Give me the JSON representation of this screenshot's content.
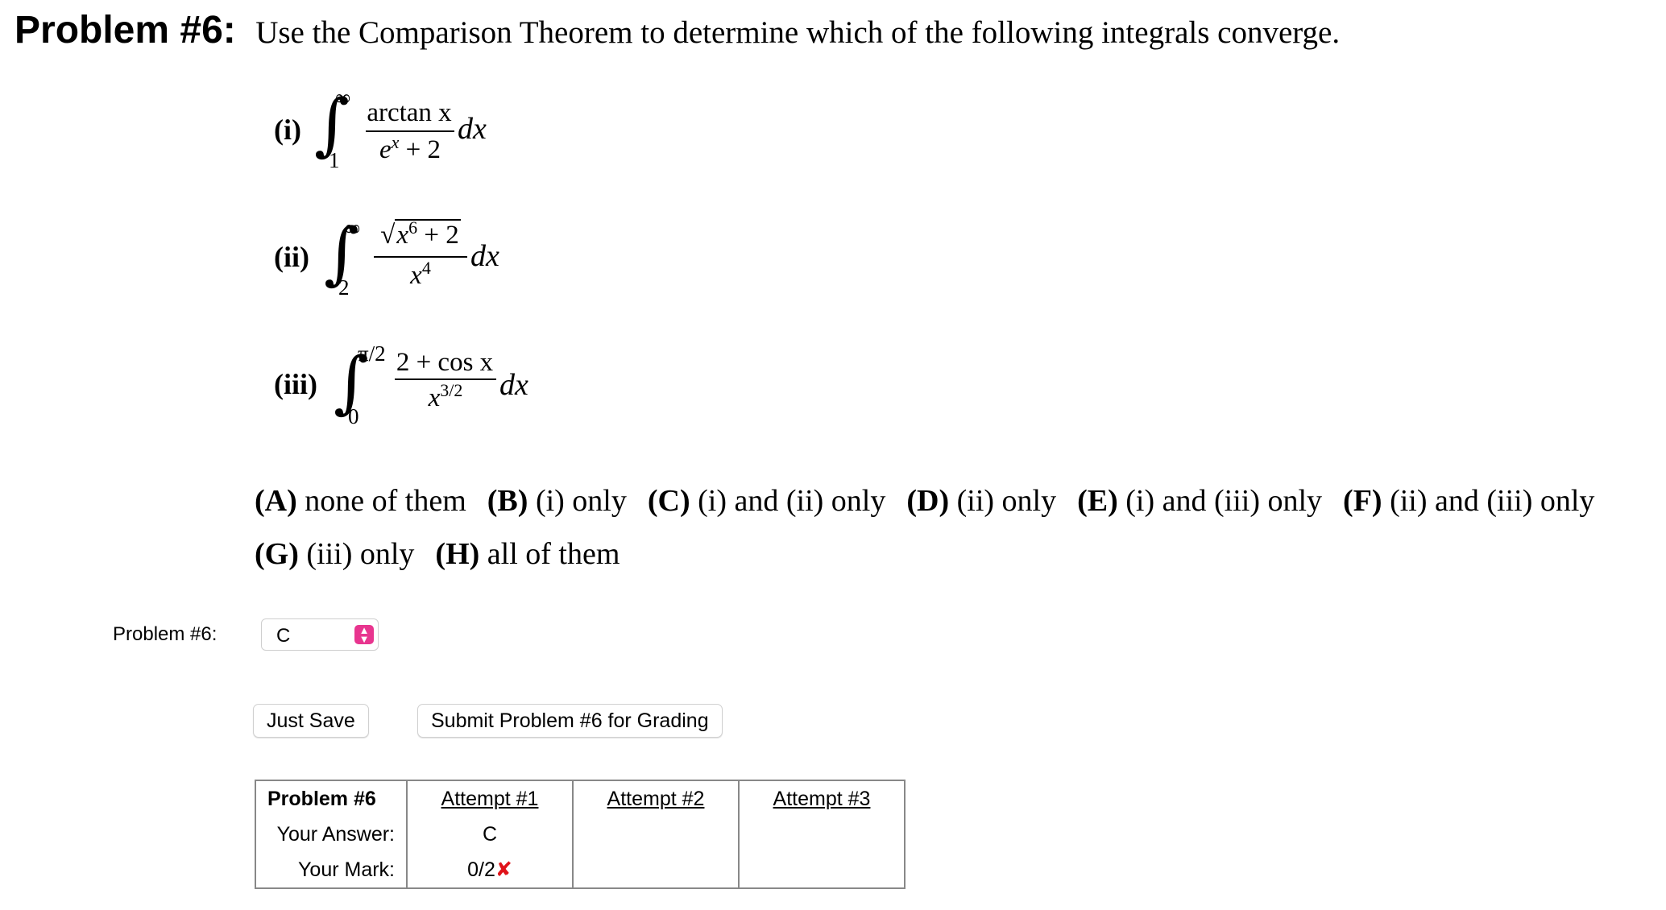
{
  "header": {
    "problem_number": "Problem #6:",
    "instruction": "Use the Comparison Theorem to determine which of the following integrals converge."
  },
  "integrals": [
    {
      "label": "(i)",
      "upper": "∞",
      "lower": "1",
      "numerator_text": "arctan x",
      "denominator_base": "e",
      "denominator_exp": "x",
      "denominator_rest": " + 2",
      "differential": "dx"
    },
    {
      "label": "(ii)",
      "upper": "∞",
      "lower": "2",
      "numerator_radical_base": "x",
      "numerator_radical_exp": "6",
      "numerator_radical_rest": " + 2",
      "denominator_base": "x",
      "denominator_exp": "4",
      "differential": "dx"
    },
    {
      "label": "(iii)",
      "upper": "π/2",
      "lower": "0",
      "numerator_text": "2 + cos x",
      "denominator_base": "x",
      "denominator_exp": "3/2",
      "differential": "dx"
    }
  ],
  "choices": [
    {
      "key": "(A)",
      "text": " none of them"
    },
    {
      "key": "(B)",
      "text": " (i) only"
    },
    {
      "key": "(C)",
      "text": " (i) and (ii) only"
    },
    {
      "key": "(D)",
      "text": " (ii) only"
    },
    {
      "key": "(E)",
      "text": " (i) and (iii) only"
    },
    {
      "key": "(F)",
      "text": " (ii) and (iii) only"
    },
    {
      "key": "(G)",
      "text": " (iii) only"
    },
    {
      "key": "(H)",
      "text": " all of them"
    }
  ],
  "answer": {
    "label": "Problem #6:",
    "selected": "C"
  },
  "buttons": {
    "save": "Just Save",
    "submit": "Submit Problem #6 for Grading"
  },
  "attempts_table": {
    "header_label": "Problem #6",
    "attempt_labels": [
      "Attempt #1",
      "Attempt #2",
      "Attempt #3"
    ],
    "answer_row_label": "Your Answer:",
    "mark_row_label": "Your Mark:",
    "answers": [
      "C",
      "",
      ""
    ],
    "marks": [
      "0/2",
      "",
      ""
    ],
    "mark_icons": [
      "✘",
      "",
      ""
    ]
  },
  "colors": {
    "select_arrow": "#e8358f",
    "wrong_mark": "#e0131a"
  }
}
